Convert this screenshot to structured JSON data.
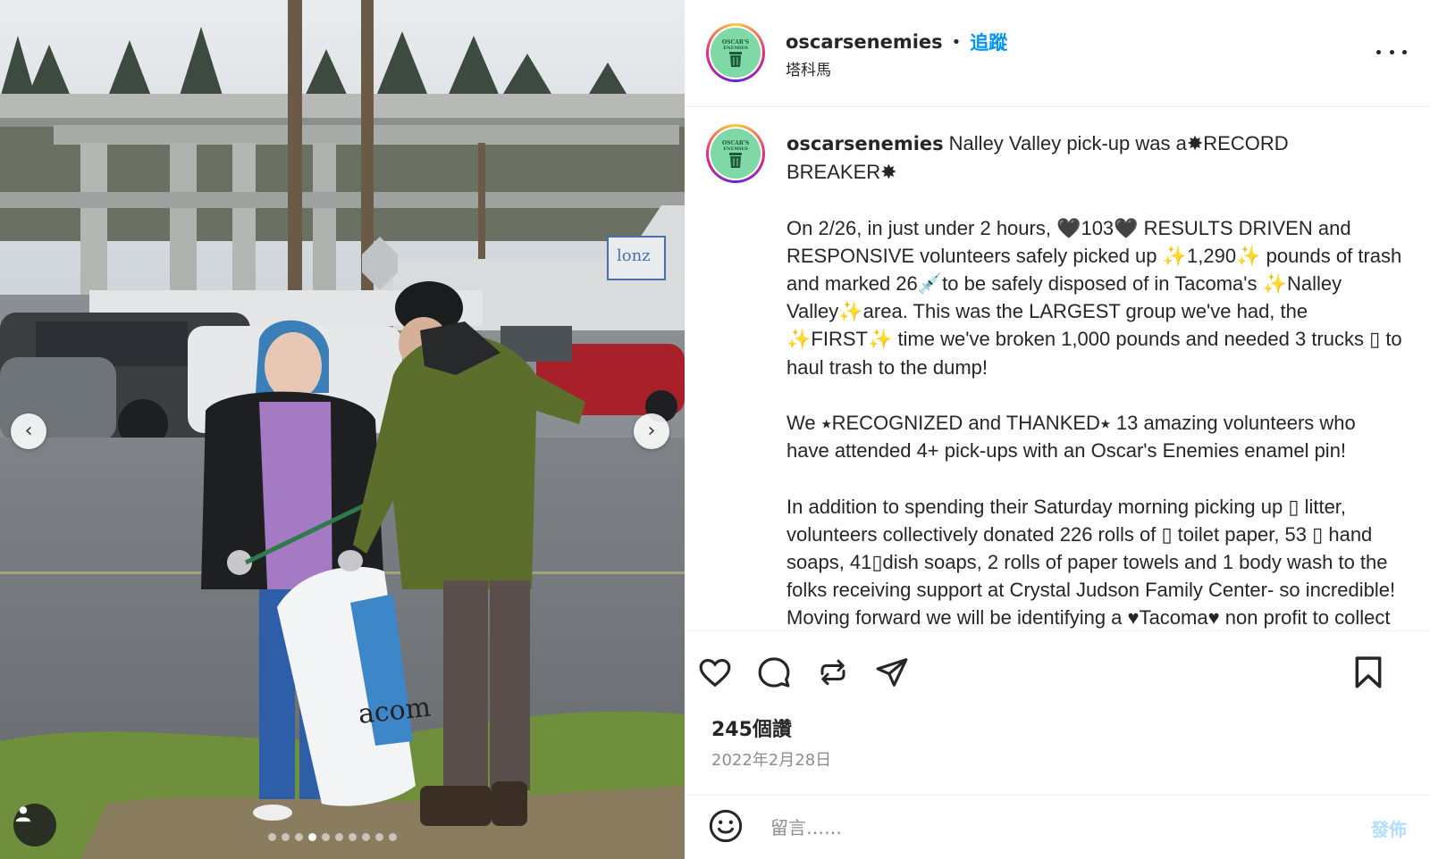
{
  "post": {
    "username": "oscarsenemies",
    "follow_label": "追蹤",
    "separator": "•",
    "location": "塔科馬",
    "avatar_text": "OSCAR'S ENEMIES",
    "caption": {
      "p1": "Nalley Valley pick-up was a✸RECORD BREAKER✸",
      "p2": "On 2/26, in just under 2 hours, 🖤103🖤 RESULTS DRIVEN and RESPONSIVE volunteers safely picked up ✨1,290✨ pounds of trash and marked 26💉to be safely disposed of in Tacoma's ✨Nalley Valley✨area. This was the LARGEST group we've had, the ✨FIRST✨ time we've broken 1,000 pounds and needed 3 trucks ▯ to haul trash to the dump!",
      "p3": "We ⭑RECOGNIZED and THANKED⭑ 13 amazing volunteers who have attended 4+ pick-ups with an Oscar's Enemies enamel pin!",
      "p4": "In addition to spending their Saturday morning picking up ▯ litter, volunteers collectively donated 226 rolls of ▯ toilet paper, 53 ▯ hand soaps, 41▯dish soaps, 2 rolls of paper towels and 1 body wash to the folks receiving support at Crystal Judson Family Center- so incredible! Moving forward we will be identifying a ♥Tacoma♥ non profit to collect donations for once a quarter!"
    },
    "likes": "245個讚",
    "date": "2022年2月28日",
    "comment_placeholder": "留言……",
    "post_label": "發佈"
  },
  "carousel": {
    "total": 10,
    "active": 4,
    "bag_text": "acom"
  },
  "icons": {
    "like": "heart-icon",
    "comment": "comment-icon",
    "share": "repost-icon",
    "send": "send-icon",
    "save": "bookmark-icon",
    "more": "more-icon",
    "emoji": "emoji-icon",
    "tag": "user-tag-icon"
  },
  "colors": {
    "link": "#0095f6",
    "post_disabled": "#b2dffc",
    "secondary_text": "#8e8e8e"
  }
}
